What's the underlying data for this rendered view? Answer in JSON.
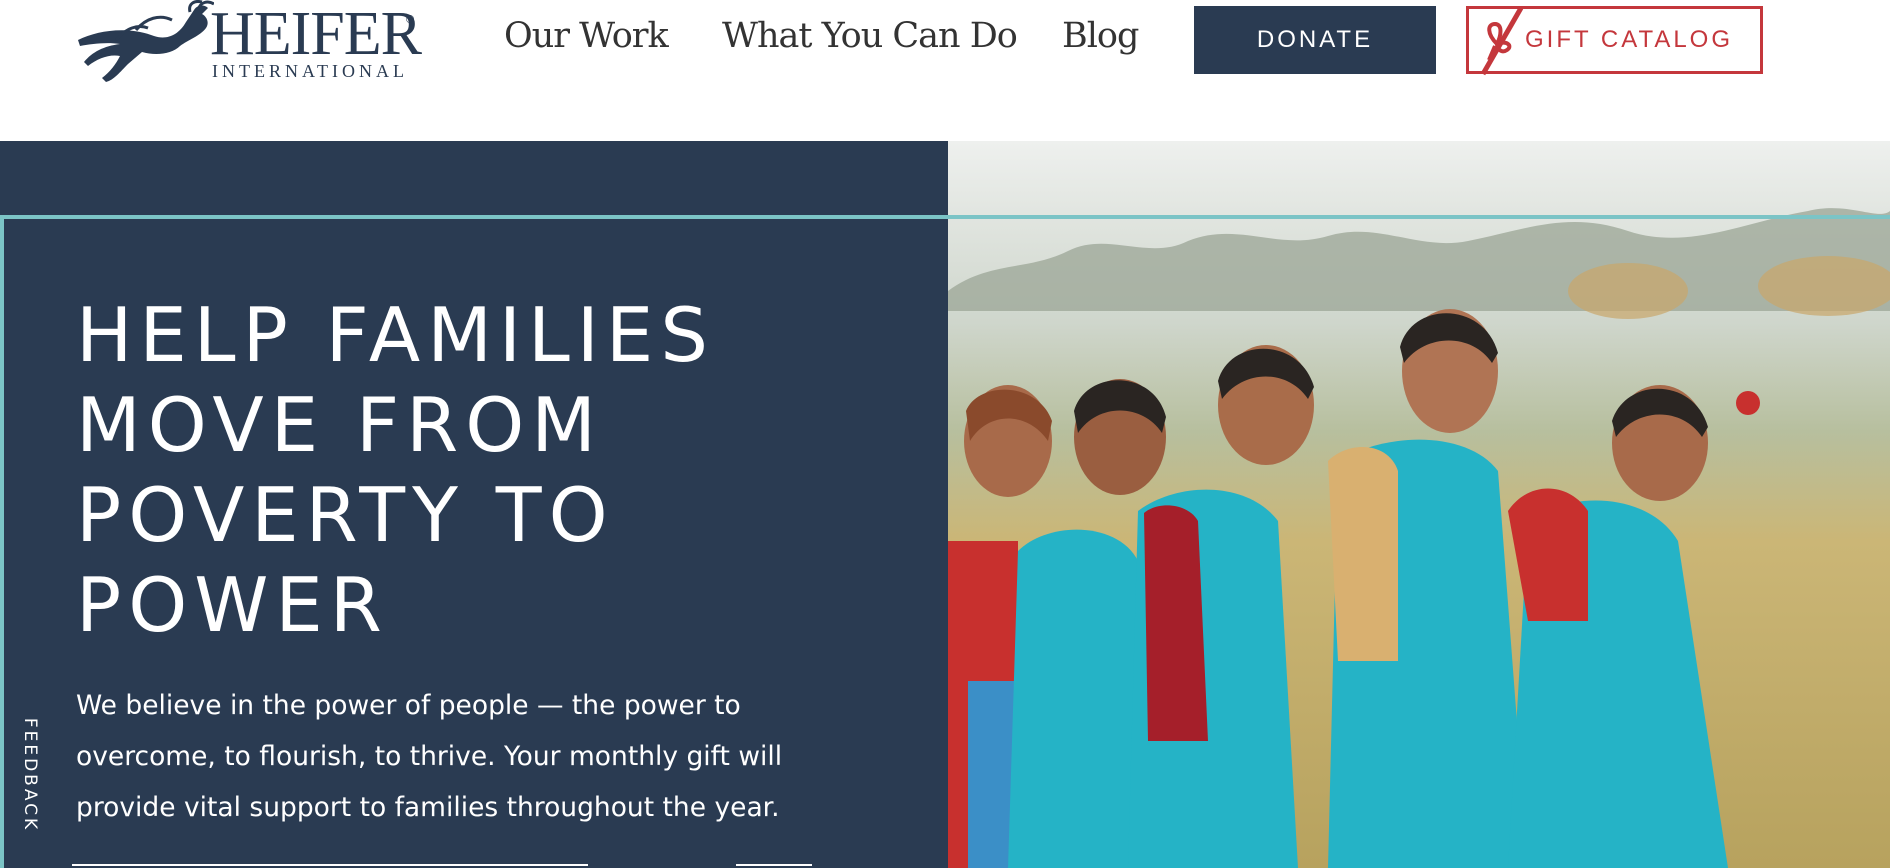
{
  "header": {
    "logo": {
      "wordmark": "HEIFER",
      "registered": "®",
      "subtitle": "INTERNATIONAL"
    },
    "nav": [
      {
        "label": "Our Work"
      },
      {
        "label": "What You Can Do"
      },
      {
        "label": "Blog"
      }
    ],
    "donate_label": "DONATE",
    "gift_catalog_label": "GIFT CATALOG"
  },
  "hero": {
    "title": "HELP FAMILIES MOVE FROM POVERTY TO POWER",
    "body": "We believe in the power of people — the power to overcome, to flourish, to thrive. Your monthly gift will provide vital support to families throughout the year.",
    "feedback_label": "FEEDBACK",
    "image_icon": "photo-five-women-in-turquoise-saris"
  },
  "colors": {
    "navy": "#2a3b52",
    "brand_red": "#c4373c",
    "teal_accent": "#7bc4c6",
    "nav_text": "#333333"
  }
}
